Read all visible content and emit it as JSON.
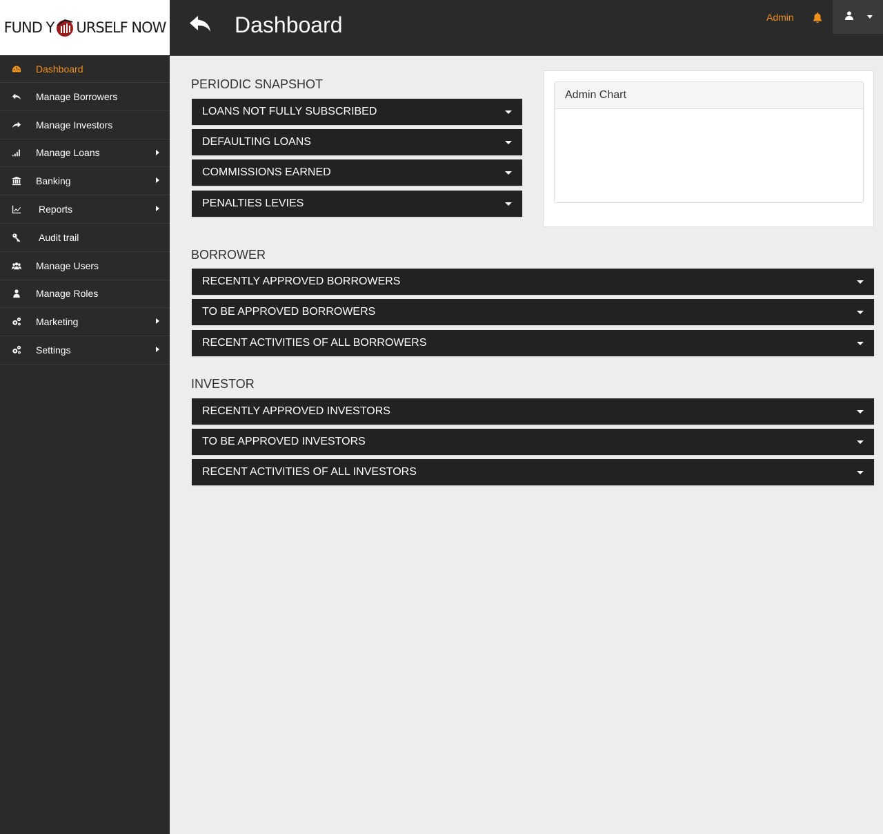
{
  "brand": {
    "logo_left": "FUND Y",
    "logo_right": "URSELF NOW",
    "accent_color": "#f0921b"
  },
  "sidebar": {
    "items": [
      {
        "label": "Dashboard",
        "icon": "dashboard-icon",
        "active": true
      },
      {
        "label": "Manage Borrowers",
        "icon": "reply-icon"
      },
      {
        "label": "Manage Investors",
        "icon": "share-icon"
      },
      {
        "label": "Manage Loans",
        "icon": "signal-icon",
        "submenu": true
      },
      {
        "label": "Banking",
        "icon": "bank-icon",
        "submenu": true
      },
      {
        "label": "Reports",
        "icon": "line-chart-icon",
        "submenu": true
      },
      {
        "label": "Audit trail",
        "icon": "key-icon"
      },
      {
        "label": "Manage Users",
        "icon": "users-icon"
      },
      {
        "label": "Manage Roles",
        "icon": "user-icon"
      },
      {
        "label": "Marketing",
        "icon": "cogs-icon",
        "submenu": true
      },
      {
        "label": "Settings",
        "icon": "cogs-icon",
        "submenu": true
      }
    ]
  },
  "header": {
    "title": "Dashboard",
    "admin_label": "Admin"
  },
  "periodic_snapshot": {
    "title": "PERIODIC SNAPSHOT",
    "items": [
      "LOANS NOT FULLY SUBSCRIBED",
      "DEFAULTING LOANS",
      "COMMISSIONS EARNED",
      "PENALTIES LEVIES"
    ]
  },
  "admin_chart": {
    "title": "Admin Chart"
  },
  "borrower": {
    "title": "BORROWER",
    "items": [
      "RECENTLY APPROVED BORROWERS",
      "TO BE APPROVED BORROWERS",
      "RECENT ACTIVITIES OF ALL BORROWERS"
    ]
  },
  "investor": {
    "title": "INVESTOR",
    "items": [
      "RECENTLY APPROVED INVESTORS",
      "TO BE APPROVED INVESTORS",
      "RECENT ACTIVITIES OF ALL INVESTORS"
    ]
  }
}
